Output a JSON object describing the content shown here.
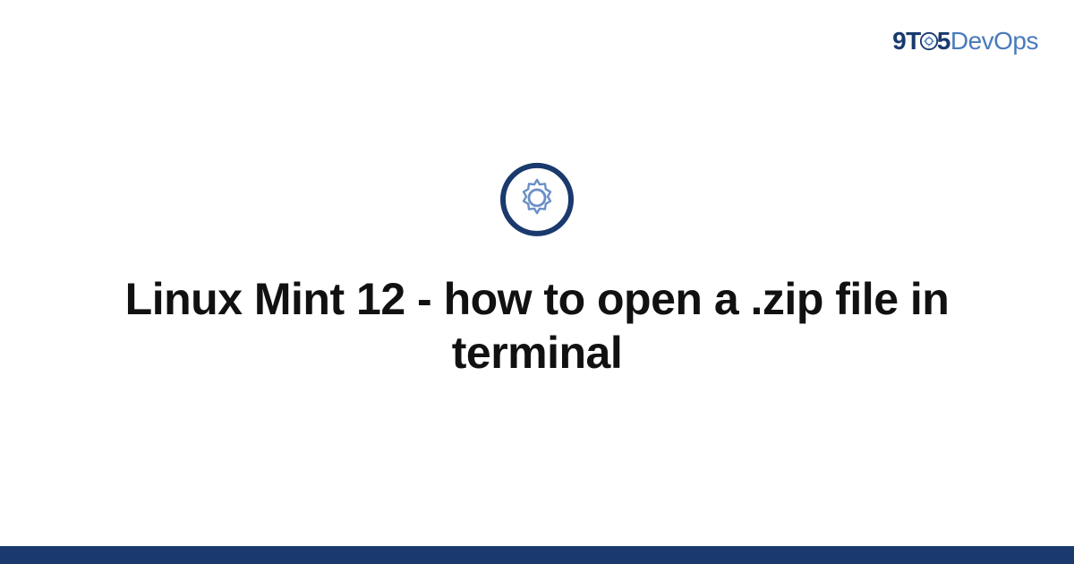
{
  "brand": {
    "part_9": "9",
    "part_t": "T",
    "part_5": "5",
    "part_devops": "DevOps"
  },
  "colors": {
    "brand_dark": "#1a3a6e",
    "brand_light": "#4a7abc",
    "gear_fill": "#6b8fc7"
  },
  "page": {
    "title": "Linux Mint 12 - how to open a .zip file in terminal"
  }
}
